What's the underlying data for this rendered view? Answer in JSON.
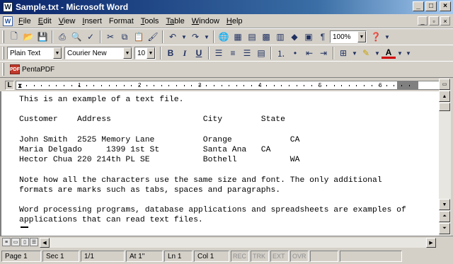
{
  "window": {
    "title": "Sample.txt - Microsoft Word",
    "app_icon_letter": "W"
  },
  "menubar": {
    "items": [
      {
        "hot": "F",
        "rest": "ile"
      },
      {
        "hot": "E",
        "rest": "dit"
      },
      {
        "hot": "V",
        "rest": "iew"
      },
      {
        "hot": "I",
        "rest": "nsert"
      },
      {
        "hot": "Fo",
        "rest": "rmat",
        "pre": ""
      },
      {
        "hot": "T",
        "rest": "ools"
      },
      {
        "hot": "Ta",
        "rest": "ble"
      },
      {
        "hot": "W",
        "rest": "indow"
      },
      {
        "hot": "H",
        "rest": "elp"
      }
    ]
  },
  "standard_toolbar": {
    "zoom": "100%"
  },
  "formatting_toolbar": {
    "style": "Plain Text",
    "font": "Courier New",
    "size": "10"
  },
  "pdf_toolbar": {
    "label": "PentaPDF"
  },
  "ruler": {
    "numbers": [
      "1",
      "2",
      "3",
      "4",
      "5",
      "6"
    ]
  },
  "document": {
    "lines": [
      "This is an example of a text file.",
      "",
      "Customer    Address                   City        State",
      "",
      "John Smith  2525 Memory Lane          Orange            CA",
      "Maria Delgado     1399 1st St         Santa Ana   CA",
      "Hector Chua 220 214th PL SE           Bothell           WA",
      "",
      "Note how all the characters use the same size and font. The only additional",
      "formats are marks such as tabs, spaces and paragraphs.",
      "",
      "Word processing programs, database applications and spreadsheets are examples of",
      "applications that can read text files."
    ]
  },
  "statusbar": {
    "page": "Page 1",
    "sec": "Sec 1",
    "pages": "1/1",
    "at": "At 1\"",
    "ln": "Ln 1",
    "col": "Col 1",
    "rec": "REC",
    "trk": "TRK",
    "ext": "EXT",
    "ovr": "OVR"
  }
}
